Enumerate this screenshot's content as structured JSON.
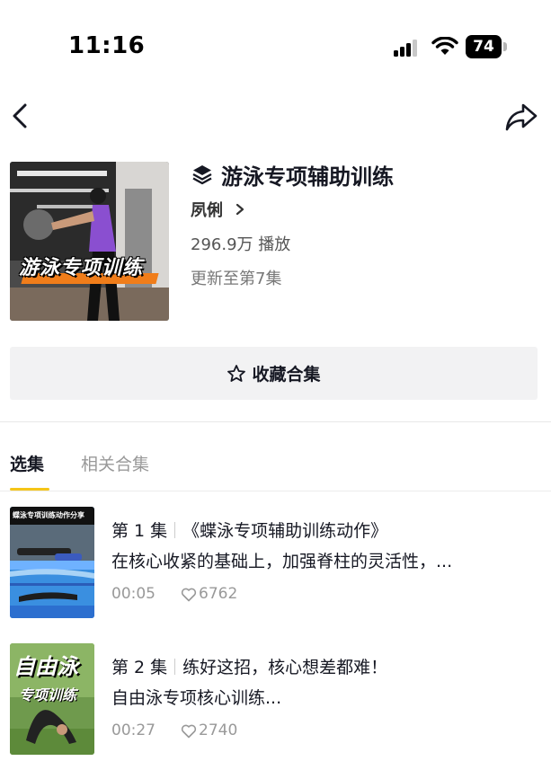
{
  "status_bar": {
    "time": "11:16",
    "battery": "74"
  },
  "collection": {
    "cover_text": "游泳专项训练",
    "title": "游泳专项辅助训练",
    "author": "夙俐",
    "plays": "296.9万 播放",
    "update": "更新至第7集",
    "favorite_label": "收藏合集"
  },
  "tabs": [
    {
      "label": "选集",
      "active": true
    },
    {
      "label": "相关合集",
      "active": false
    }
  ],
  "episodes": [
    {
      "number": "第 1 集",
      "title": "《蝶泳专项辅助训练动作》",
      "description": "在核心收紧的基础上，加强脊柱的灵活性，...",
      "duration": "00:05",
      "likes": "6762",
      "thumb_text": "蝶泳专项训练动作分享"
    },
    {
      "number": "第 2 集",
      "title": "练好这招，核心想差都难！",
      "description": "自由泳专项核心训练...",
      "duration": "00:27",
      "likes": "2740",
      "thumb_text_1": "自由泳",
      "thumb_text_2": "专项训练"
    }
  ],
  "colors": {
    "accent": "#f5c518",
    "cover_stripe": "#f07d1a",
    "pool": "#2f7fd6"
  }
}
